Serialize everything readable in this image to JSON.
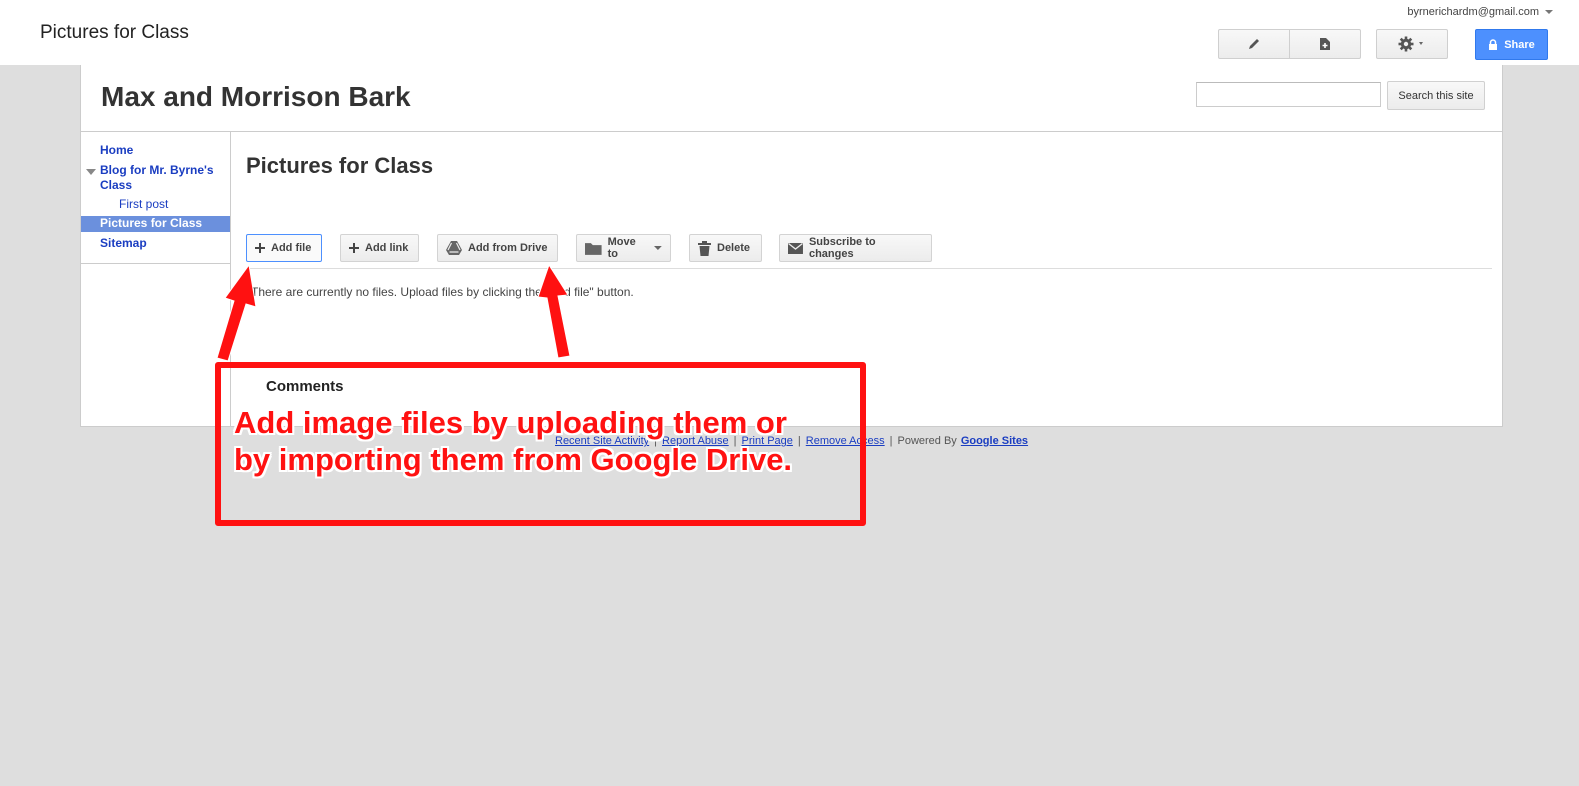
{
  "header": {
    "page_title": "Pictures for Class",
    "account": "byrnerichardm@gmail.com",
    "share_label": "Share",
    "icons": [
      "pencil-icon",
      "new-page-icon",
      "gear-icon",
      "lock-icon"
    ]
  },
  "site": {
    "title": "Max and Morrison Bark",
    "search_button": "Search this site",
    "search_placeholder": ""
  },
  "sidebar": {
    "items": [
      {
        "label": "Home"
      },
      {
        "label": "Blog for Mr. Byrne's"
      },
      {
        "label": "Class"
      },
      {
        "label": "First post"
      },
      {
        "label": "Pictures for Class"
      },
      {
        "label": "Sitemap"
      }
    ]
  },
  "main": {
    "title": "Pictures for Class",
    "buttons": {
      "add_file": "Add file",
      "add_link": "Add link",
      "add_from_drive": "Add from Drive",
      "move_to": "Move to",
      "delete": "Delete",
      "subscribe": "Subscribe to changes"
    },
    "no_files": "There are currently no files. Upload files by clicking the \"Add file\" button.",
    "comments": "Comments"
  },
  "footer": {
    "recent": "Recent Site Activity",
    "report": "Report Abuse",
    "print": "Print Page",
    "remove": "Remove Access",
    "powered_by": "Powered By",
    "google_sites": "Google Sites",
    "sep": "|"
  },
  "annotation": {
    "line1": "Add image files by uploading them or",
    "line2": "by importing them from Google Drive.",
    "color": "#ff1111"
  }
}
